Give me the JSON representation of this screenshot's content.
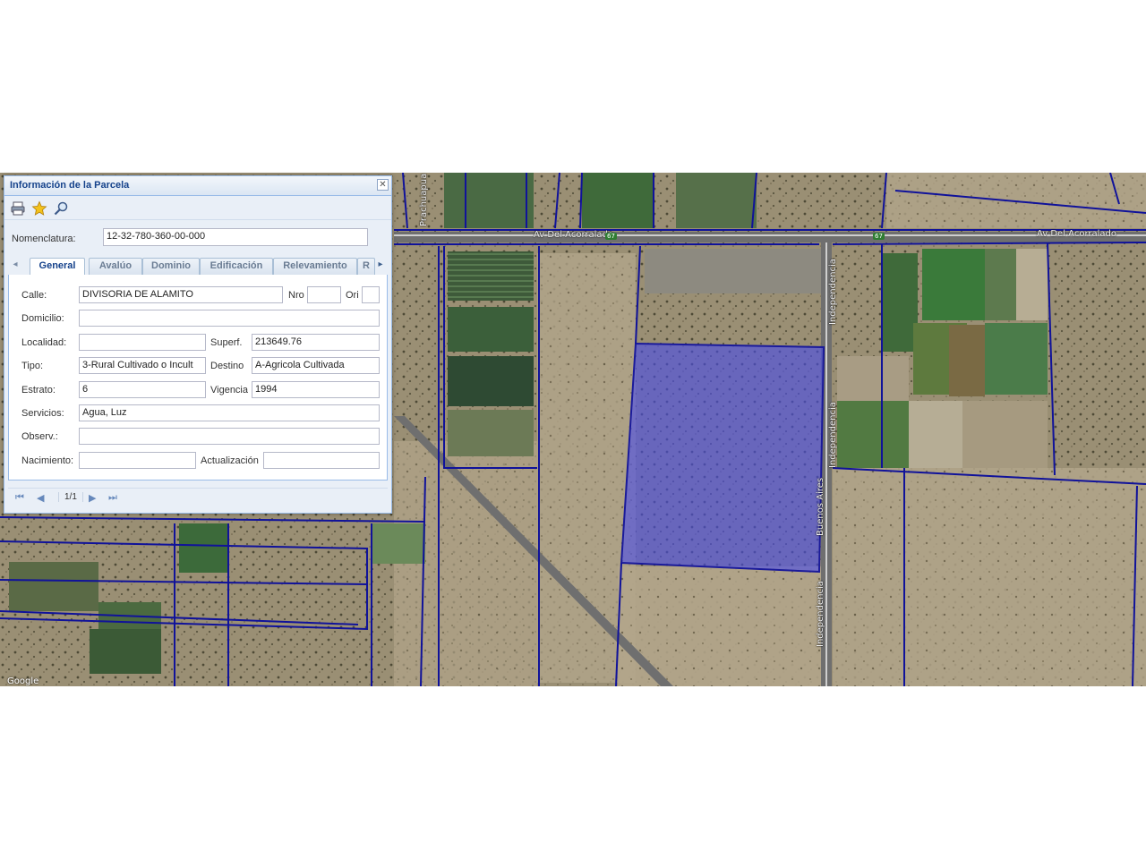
{
  "map": {
    "roads": {
      "top_road": "Av Del Acorralado",
      "top_road_right": "Av Del Acorralado",
      "route_shield": "67",
      "independencia_1": "Independencia",
      "independencia_2": "Independencia",
      "independencia_3": "Independencia",
      "side_street": "Prachuapua",
      "diagonal_road": "Buenos Aires"
    },
    "credit": "Google",
    "colors": {
      "parcel_fill": "#4a4ee8",
      "parcel_stroke": "#1a1a9a",
      "boundary": "#10129a"
    }
  },
  "panel": {
    "title": "Información de la Parcela",
    "toolbar": {
      "print": "print-icon",
      "favorite": "star-icon",
      "zoom": "zoom-icon"
    },
    "nomenclatura": {
      "label": "Nomenclatura:",
      "value": "12-32-780-360-00-000"
    },
    "tabs": [
      {
        "label": "General"
      },
      {
        "label": "Avalúo"
      },
      {
        "label": "Dominio"
      },
      {
        "label": "Edificación"
      },
      {
        "label": "Relevamiento"
      },
      {
        "label": "R"
      }
    ],
    "active_tab": "General",
    "fields": {
      "calle": {
        "label": "Calle:",
        "value": "DIVISORIA DE ALAMITO"
      },
      "nro": {
        "label": "Nro",
        "value": ""
      },
      "ori": {
        "label": "Ori",
        "value": ""
      },
      "domicilio": {
        "label": "Domicilio:",
        "value": ""
      },
      "localidad": {
        "label": "Localidad:",
        "value": ""
      },
      "superf": {
        "label": "Superf.",
        "value": "213649.76"
      },
      "tipo": {
        "label": "Tipo:",
        "value": "3-Rural Cultivado o Incult"
      },
      "destino": {
        "label": "Destino",
        "value": "A-Agricola Cultivada"
      },
      "estrato": {
        "label": "Estrato:",
        "value": "6"
      },
      "vigencia": {
        "label": "Vigencia",
        "value": "1994"
      },
      "servicios": {
        "label": "Servicios:",
        "value": "Agua, Luz"
      },
      "observ": {
        "label": "Observ.:",
        "value": ""
      },
      "nacimiento": {
        "label": "Nacimiento:",
        "value": ""
      },
      "actualizacion": {
        "label": "Actualización",
        "value": ""
      }
    },
    "pager": {
      "text": "1/1"
    }
  }
}
